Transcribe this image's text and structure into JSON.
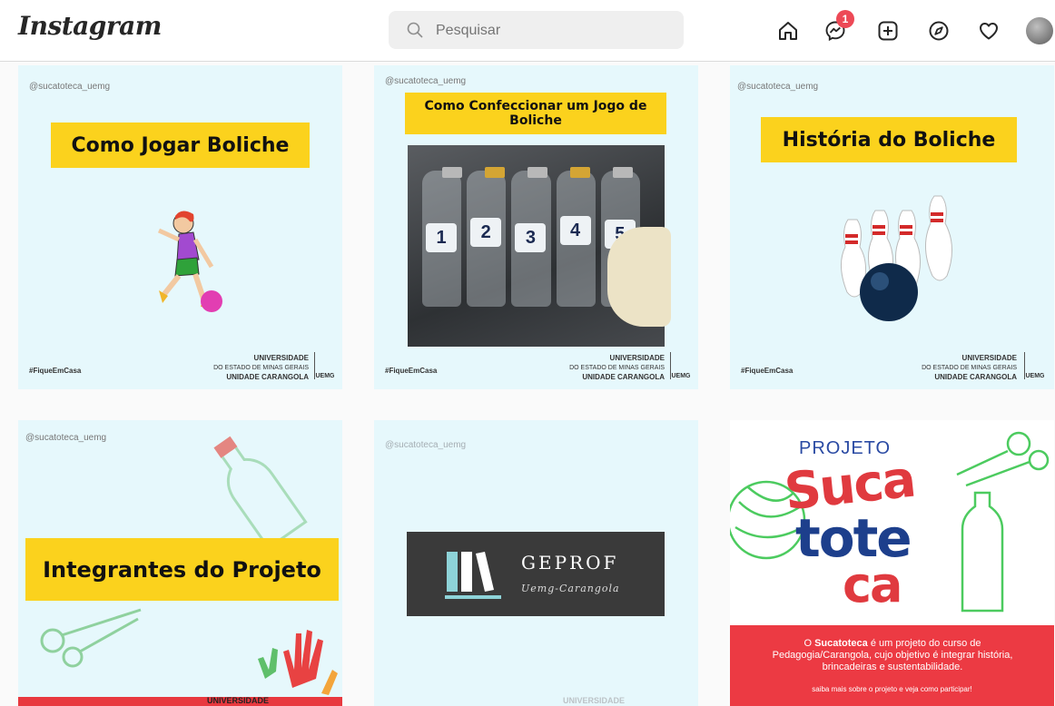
{
  "header": {
    "logo": "Instagram",
    "search_placeholder": "Pesquisar",
    "messages_badge": "1",
    "icons": [
      "home-icon",
      "messenger-icon",
      "new-post-icon",
      "explore-icon",
      "activity-icon",
      "profile-avatar"
    ]
  },
  "posts": [
    {
      "handle": "@sucatoteca_uemg",
      "title": "Como Jogar Boliche",
      "tag": "#FiqueEmCasa",
      "uni_name": "UNIVERSIDADE",
      "uni_sub": "DO ESTADO DE MINAS GERAIS",
      "uni_unit": "UNIDADE CARANGOLA",
      "uni_short": "UEMG"
    },
    {
      "handle": "@sucatoteca_uemg",
      "title": "Como Confeccionar um Jogo de Boliche",
      "bottle_numbers": [
        "1",
        "2",
        "3",
        "4",
        "5"
      ],
      "tag": "#FiqueEmCasa",
      "uni_name": "UNIVERSIDADE",
      "uni_sub": "DO ESTADO DE MINAS GERAIS",
      "uni_unit": "UNIDADE CARANGOLA",
      "uni_short": "UEMG"
    },
    {
      "handle": "@sucatoteca_uemg",
      "title": "História do Boliche",
      "tag": "#FiqueEmCasa",
      "uni_name": "UNIVERSIDADE",
      "uni_sub": "DO ESTADO DE MINAS GERAIS",
      "uni_unit": "UNIDADE CARANGOLA",
      "uni_short": "UEMG"
    },
    {
      "handle": "@sucatoteca_uemg",
      "title": "Integrantes do Projeto",
      "uni_name": "UNIVERSIDADE"
    },
    {
      "handle": "@sucatoteca_uemg",
      "logo_title": "GEPROF",
      "logo_subtitle": "Uemg-Carangola",
      "uni_name": "UNIVERSIDADE"
    },
    {
      "projeto": "PROJETO",
      "word_top": "Suca",
      "word_mid": "tote",
      "word_bottom": "ca",
      "description_lead": "O ",
      "description_brand": "Sucatoteca",
      "description_rest": " é um projeto do curso de Pedagogia/Carangola, cujo objetivo é integrar história, brincadeiras e sustentabilidade.",
      "cta": "saiba mais sobre o projeto e veja como participar!"
    }
  ]
}
